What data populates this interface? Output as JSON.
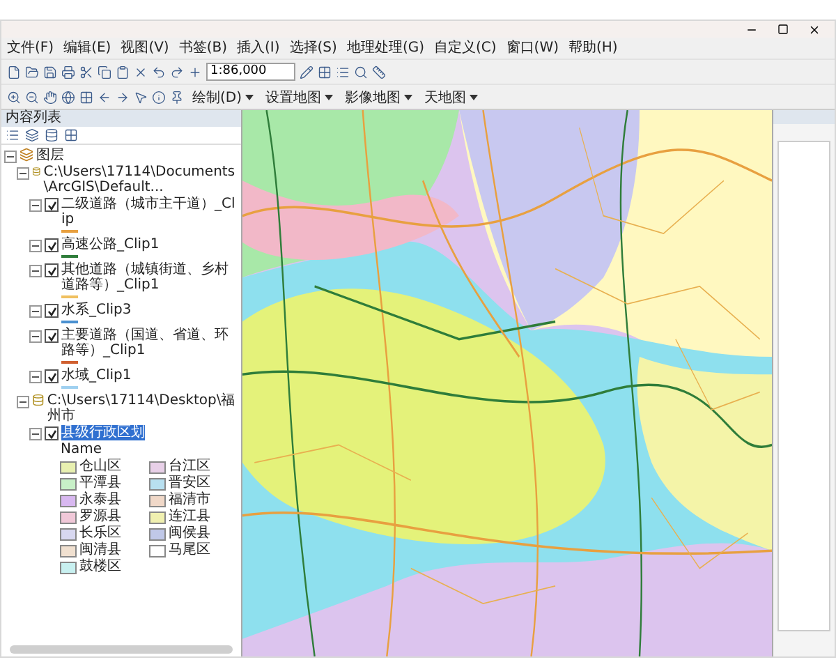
{
  "menu": [
    "文件(F)",
    "编辑(E)",
    "视图(V)",
    "书签(B)",
    "插入(I)",
    "选择(S)",
    "地理处理(G)",
    "自定义(C)",
    "窗口(W)",
    "帮助(H)"
  ],
  "toolbar": {
    "scale": "1:86,000",
    "dropdowns": [
      "绘制(D)",
      "设置地图",
      "影像地图",
      "天地图"
    ]
  },
  "toc": {
    "title": "内容列表",
    "tree": [
      {
        "kind": "group",
        "label": "图层",
        "expanded": true,
        "children": [
          {
            "kind": "source",
            "label": "C:\\Users\\17114\\Documents\\ArcGIS\\Default...",
            "expanded": true,
            "children": [
              {
                "kind": "layer",
                "label": "二级道路（城市主干道）_Clip",
                "checked": true,
                "selected": false,
                "expanded": true,
                "color": "#e8a040"
              },
              {
                "kind": "layer",
                "label": "高速公路_Clip1",
                "checked": true,
                "selected": false,
                "expanded": true,
                "color": "#2f7d3a"
              },
              {
                "kind": "layer",
                "label": "其他道路（城镇街道、乡村道路等）_Clip1",
                "checked": true,
                "selected": false,
                "expanded": true,
                "color": "#f0c060"
              },
              {
                "kind": "layer",
                "label": "水系_Clip3",
                "checked": true,
                "selected": false,
                "expanded": true,
                "color": "#4a90d0"
              },
              {
                "kind": "layer",
                "label": "主要道路（国道、省道、环路等）_Clip1",
                "checked": true,
                "selected": false,
                "expanded": true,
                "color": "#d06030"
              },
              {
                "kind": "layer",
                "label": "水域_Clip1",
                "checked": true,
                "selected": false,
                "expanded": true,
                "color": "#9fd0f0"
              }
            ]
          },
          {
            "kind": "source",
            "label": "C:\\Users\\17114\\Desktop\\福州市",
            "expanded": true,
            "children": [
              {
                "kind": "layer",
                "label": "县级行政区划",
                "checked": true,
                "selected": true,
                "expanded": true,
                "heading": "Name",
                "legend": [
                  {
                    "label": "仓山区",
                    "color": "#e8f0b0"
                  },
                  {
                    "label": "台江区",
                    "color": "#e8d0e8"
                  },
                  {
                    "label": "平潭县",
                    "color": "#c8f0c8"
                  },
                  {
                    "label": "晋安区",
                    "color": "#b8e0f0"
                  },
                  {
                    "label": "永泰县",
                    "color": "#d8b8f0"
                  },
                  {
                    "label": "福清市",
                    "color": "#f0d8c8"
                  },
                  {
                    "label": "罗源县",
                    "color": "#f0c8d8"
                  },
                  {
                    "label": "连江县",
                    "color": "#f0f0b0"
                  },
                  {
                    "label": "长乐区",
                    "color": "#d8d8f0"
                  },
                  {
                    "label": "闽侯县",
                    "color": "#c0c8e8"
                  },
                  {
                    "label": "闽清县",
                    "color": "#f0e0d0"
                  },
                  {
                    "label": "马尾区",
                    "color": "#ffffff"
                  },
                  {
                    "label": "鼓楼区",
                    "color": "#c8f0f0"
                  }
                ]
              }
            ]
          }
        ]
      }
    ]
  }
}
